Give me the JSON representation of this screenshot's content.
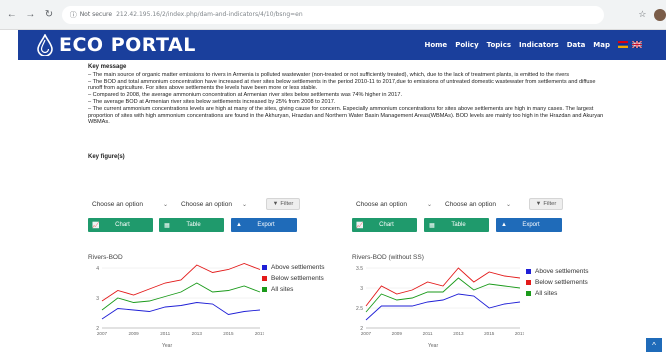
{
  "browser": {
    "back": "←",
    "forward": "→",
    "reload": "↻",
    "security": "Not secure",
    "url": "212.42.195.16/2/index.php/dam-and-indicators/4/10/bsng=en",
    "star": "☆"
  },
  "header": {
    "title": "ECO PORTAL",
    "menu": [
      "Home",
      "Policy",
      "Topics",
      "Indicators",
      "Data",
      "Map"
    ],
    "colors": {
      "header_bg": "#1a3f9c"
    }
  },
  "key_message": {
    "heading": "Key message",
    "paragraphs": [
      "– The main source of organic matter emissions to rivers in Armenia is polluted wastewater (non-treated or not sufficiently treated), which, due to the lack of treatment plants, is emitted to the rivers",
      "– The BOD and total ammonium concentration have increased at river sites below settlements in the period 2010-11 to 2017,due to emissions of untreated domestic wastewater from settlements and diffuse runoff from agriculture. For sites above settlements the levels have been more or less stable.",
      "– Compared to 2008, the average ammonium concentration at Armenian river sites below settlements was 74% higher in 2017.",
      "– The average BOD at Armenian river sites below settlements increased by 25% from 2008 to 2017.",
      "– The current ammonium concentrations levels are high at many of the sites, giving cause for concern. Especially ammonium concentrations for sites above settlements are high in many cases. The largest proportion of sites with high ammonium concentrations are found in the Akhuryan, Hrazdan and Northern Water Basin Management Areas(WBMAs). BOD levels are mainly too high in the Hrazdan and Akuryan WBMAs."
    ]
  },
  "key_figures_title": "Key figure(s)",
  "panels": [
    {
      "select1": "Choose an option",
      "select2": "Choose an option",
      "filter": "Filter",
      "buttons": {
        "chart": "Chart",
        "table": "Table",
        "export": "Export"
      },
      "chart_title": "Rivers-BOD",
      "xlabel": "Year"
    },
    {
      "select1": "Choose an option",
      "select2": "Choose an option",
      "filter": "Filter",
      "buttons": {
        "chart": "Chart",
        "table": "Table",
        "export": "Export"
      },
      "chart_title": "Rivers-BOD (without SS)",
      "xlabel": "Year"
    }
  ],
  "chart_data": [
    {
      "type": "line",
      "title": "Rivers-BOD",
      "xlabel": "Year",
      "ylabel": "",
      "x": [
        2007,
        2008,
        2009,
        2010,
        2011,
        2012,
        2013,
        2014,
        2015,
        2016,
        2017
      ],
      "xticks": [
        2007,
        2009,
        2011,
        2013,
        2015,
        2017
      ],
      "ylim": [
        2,
        4
      ],
      "yticks": [
        2,
        3,
        4
      ],
      "series": [
        {
          "name": "Above settlements",
          "color": "#1f1fd6",
          "values": [
            2.3,
            2.65,
            2.6,
            2.55,
            2.7,
            2.75,
            2.85,
            2.8,
            2.45,
            2.55,
            2.6
          ]
        },
        {
          "name": "Below settlements",
          "color": "#e31a1a",
          "values": [
            2.9,
            3.25,
            3.1,
            3.3,
            3.5,
            3.6,
            4.1,
            3.85,
            3.95,
            4.15,
            3.95
          ]
        },
        {
          "name": "All sites",
          "color": "#1a9a1a",
          "values": [
            2.6,
            3.0,
            2.85,
            2.9,
            3.05,
            3.2,
            3.5,
            3.2,
            3.25,
            3.4,
            3.2
          ]
        }
      ],
      "legend": "right"
    },
    {
      "type": "line",
      "title": "Rivers-BOD (without SS)",
      "xlabel": "Year",
      "ylabel": "",
      "x": [
        2007,
        2008,
        2009,
        2010,
        2011,
        2012,
        2013,
        2014,
        2015,
        2016,
        2017
      ],
      "xticks": [
        2007,
        2009,
        2011,
        2013,
        2015,
        2017
      ],
      "ylim": [
        2,
        3.5
      ],
      "yticks": [
        2,
        2.5,
        3,
        3.5
      ],
      "series": [
        {
          "name": "Above settlements",
          "color": "#1f1fd6",
          "values": [
            2.2,
            2.55,
            2.55,
            2.55,
            2.65,
            2.7,
            2.85,
            2.8,
            2.5,
            2.6,
            2.65
          ]
        },
        {
          "name": "Below settlements",
          "color": "#e31a1a",
          "values": [
            2.55,
            3.05,
            2.85,
            2.95,
            3.15,
            3.05,
            3.5,
            3.15,
            3.4,
            3.3,
            3.25
          ]
        },
        {
          "name": "All sites",
          "color": "#1a9a1a",
          "values": [
            2.4,
            2.85,
            2.7,
            2.75,
            2.9,
            2.9,
            3.25,
            2.95,
            3.1,
            3.05,
            3.0
          ]
        }
      ],
      "legend": "right"
    }
  ],
  "scroll_top": "^"
}
